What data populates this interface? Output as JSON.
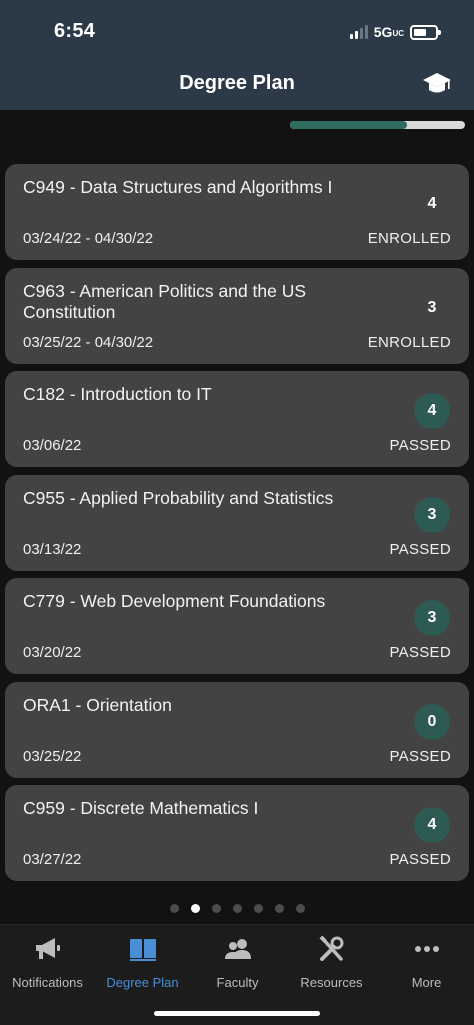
{
  "status_bar": {
    "time": "6:54",
    "network": "5G",
    "network_suffix": "UC"
  },
  "header": {
    "title": "Degree Plan",
    "cap_icon": "graduation-cap-icon"
  },
  "progress": {
    "fraction": 0.67
  },
  "courses": [
    {
      "title": "C949 - Data Structures and Algorithms I",
      "dates": "03/24/22 - 04/30/22",
      "status": "ENROLLED",
      "cu": "4",
      "badge": "none"
    },
    {
      "title": "C963 - American Politics and the US Constitution",
      "dates": "03/25/22 - 04/30/22",
      "status": "ENROLLED",
      "cu": "3",
      "badge": "none"
    },
    {
      "title": "C182 - Introduction to IT",
      "dates": "03/06/22",
      "status": "PASSED",
      "cu": "4",
      "badge": "passed"
    },
    {
      "title": "C955 - Applied Probability and Statistics",
      "dates": "03/13/22",
      "status": "PASSED",
      "cu": "3",
      "badge": "passed"
    },
    {
      "title": "C779 - Web Development Foundations",
      "dates": "03/20/22",
      "status": "PASSED",
      "cu": "3",
      "badge": "passed"
    },
    {
      "title": "ORA1 - Orientation",
      "dates": "03/25/22",
      "status": "PASSED",
      "cu": "0",
      "badge": "passed"
    },
    {
      "title": "C959 - Discrete Mathematics I",
      "dates": "03/27/22",
      "status": "PASSED",
      "cu": "4",
      "badge": "passed"
    }
  ],
  "pager": {
    "count": 7,
    "active_index": 1
  },
  "tabs": [
    {
      "label": "Notifications",
      "icon": "megaphone-icon"
    },
    {
      "label": "Degree Plan",
      "icon": "book-icon",
      "active": true
    },
    {
      "label": "Faculty",
      "icon": "people-icon"
    },
    {
      "label": "Resources",
      "icon": "tools-icon"
    },
    {
      "label": "More",
      "icon": "more-dots-icon"
    }
  ],
  "colors": {
    "header_bg": "#2c3a48",
    "card_bg": "#434343",
    "passed_badge": "#2d5a53",
    "progress": "#2f6b5e",
    "active_tab": "#4a8fd6"
  }
}
